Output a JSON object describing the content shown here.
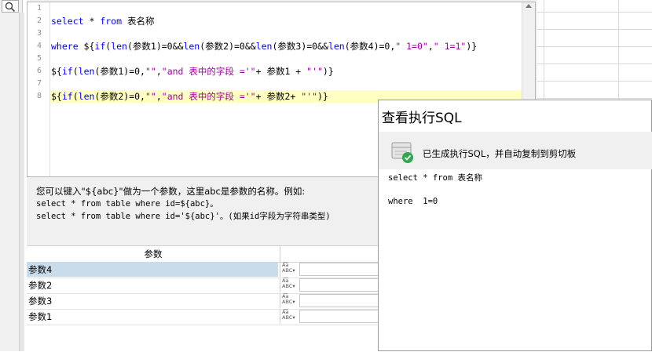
{
  "editor": {
    "lines": [
      {
        "num": "1",
        "text": ""
      },
      {
        "num": "2",
        "text": "select * from 表名称"
      },
      {
        "num": "3",
        "text": ""
      },
      {
        "num": "4",
        "text": "where ${if(len(参数1)=0&&len(参数2)=0&&len(参数3)=0&&len(参数4)=0,\" 1=0\",\" 1=1\")}"
      },
      {
        "num": "5",
        "text": ""
      },
      {
        "num": "6",
        "text": "${if(len(参数1)=0,\"\",\"and 表中的字段 ='\"+ 参数1 + \"'\")}"
      },
      {
        "num": "7",
        "text": ""
      },
      {
        "num": "8",
        "text": "${if(len(参数2)=0,\"\",\"and 表中的字段 ='\"+ 参数2+ \"'\")}"
      }
    ]
  },
  "hint": {
    "line1": "您可以键入\"${abc}\"做为一个参数，这里abc是参数的名称。例如:",
    "line2": "select * from table where id=${abc}。",
    "line3": "select * from table where id='${abc}'。(如果id字段为字符串类型)"
  },
  "params": {
    "header": "参数",
    "type_icon_label": "ABC",
    "rows": [
      {
        "name": "参数4",
        "selected": true
      },
      {
        "name": "参数2",
        "selected": false
      },
      {
        "name": "参数3",
        "selected": false
      },
      {
        "name": "参数1",
        "selected": false
      }
    ]
  },
  "sql_window": {
    "title": "查看执行SQL",
    "banner_icon": "database-check-icon",
    "banner_text": "已生成执行SQL，并自动复制到剪切板",
    "output_line1": "select * from 表名称",
    "output_line2": "",
    "output_line3": "where  1=0"
  },
  "colors": {
    "keyword": "#0000ff",
    "string": "#a000a0",
    "highlight": "#ffffc0",
    "selection": "#c8dcec",
    "check_green": "#2fa84f"
  }
}
